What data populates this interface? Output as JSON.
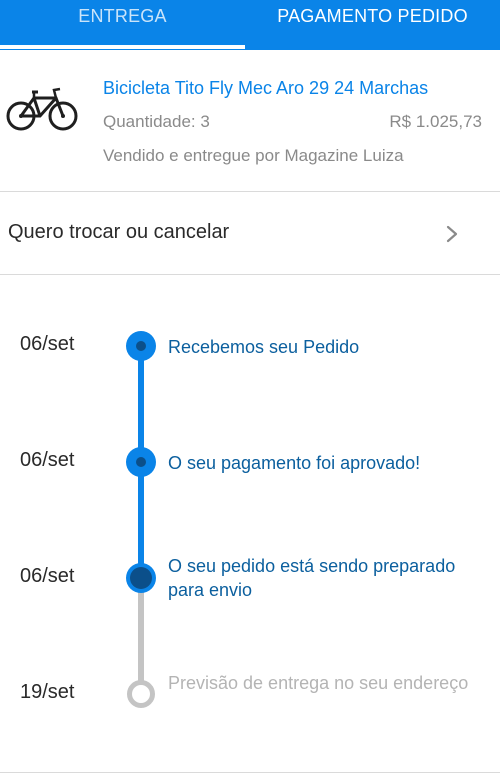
{
  "tabs": [
    {
      "label": "ENTREGA"
    },
    {
      "label": "PAGAMENTO PEDIDO"
    }
  ],
  "product": {
    "title": "Bicicleta Tito Fly Mec Aro 29 24 Marchas",
    "quantity": "Quantidade: 3",
    "price": "R$ 1.025,73",
    "seller": "Vendido e entregue por Magazine Luiza",
    "image_icon": "bicycle-icon"
  },
  "exchange": {
    "label": "Quero trocar ou cancelar",
    "icon": "chevron-right-icon"
  },
  "timeline": {
    "steps": [
      {
        "date": "06/set",
        "text": "Recebemos seu Pedido",
        "status": "done"
      },
      {
        "date": "06/set",
        "text": "O seu pagamento foi aprovado!",
        "status": "done"
      },
      {
        "date": "06/set",
        "text": "O seu pedido está sendo preparado para envio",
        "status": "current"
      },
      {
        "date": "19/set",
        "text": "Previsão de entrega no seu endereço",
        "status": "pending"
      }
    ]
  },
  "colors": {
    "primary": "#0a84e8",
    "dark_blue": "#0b4f8a",
    "pending_gray": "#c4c4c4"
  }
}
